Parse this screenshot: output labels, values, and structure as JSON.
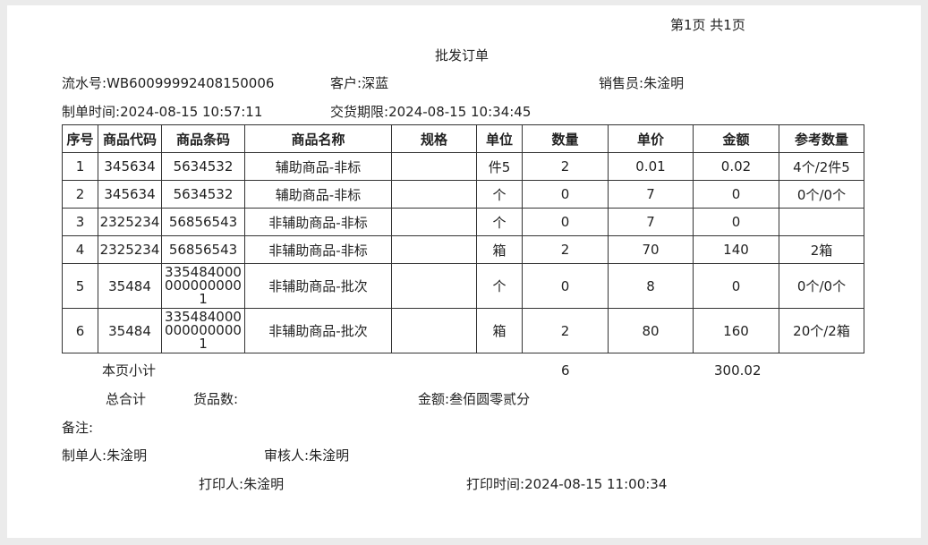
{
  "header": {
    "page_indicator": "第1页 共1页",
    "title": "批发订单",
    "serial_label": "流水号:",
    "serial_value": "WB60099992408150006",
    "customer_label": "客户:",
    "customer_value": "深蓝",
    "salesperson_label": "销售员:",
    "salesperson_value": "朱淦明",
    "created_time_label": "制单时间:",
    "created_time_value": "2024-08-15 10:57:11",
    "delivery_label": "交货期限:",
    "delivery_value": "2024-08-15 10:34:45"
  },
  "table": {
    "columns": [
      "序号",
      "商品代码",
      "商品条码",
      "商品名称",
      "规格",
      "单位",
      "数量",
      "单价",
      "金额",
      "参考数量"
    ],
    "rows": [
      [
        "1",
        "345634",
        "5634532",
        "辅助商品-非标",
        "",
        "件5",
        "2",
        "0.01",
        "0.02",
        "4个/2件5"
      ],
      [
        "2",
        "345634",
        "5634532",
        "辅助商品-非标",
        "",
        "个",
        "0",
        "7",
        "0",
        "0个/0个"
      ],
      [
        "3",
        "2325234",
        "56856543",
        "非辅助商品-非标",
        "",
        "个",
        "0",
        "7",
        "0",
        ""
      ],
      [
        "4",
        "2325234",
        "56856543",
        "非辅助商品-非标",
        "",
        "箱",
        "2",
        "70",
        "140",
        "2箱"
      ],
      [
        "5",
        "35484",
        "3354840000000000001",
        "非辅助商品-批次",
        "",
        "个",
        "0",
        "8",
        "0",
        "0个/0个"
      ],
      [
        "6",
        "35484",
        "3354840000000000001",
        "非辅助商品-批次",
        "",
        "箱",
        "2",
        "80",
        "160",
        "20个/2箱"
      ]
    ]
  },
  "summary": {
    "page_subtotal_label": "本页小计",
    "page_subtotal_qty": "6",
    "page_subtotal_amount": "300.02",
    "grand_total_label": "总合计",
    "goods_count_label": "货品数:",
    "amount_label": "金额:",
    "amount_value": "叁佰圆零贰分"
  },
  "footer": {
    "remark_label": "备注:",
    "creator_label": "制单人:",
    "creator_value": "朱淦明",
    "reviewer_label": "审核人:",
    "reviewer_value": "朱淦明",
    "printer_label": "打印人:",
    "printer_value": "朱淦明",
    "print_time_label": "打印时间:",
    "print_time_value": "2024-08-15 11:00:34"
  }
}
